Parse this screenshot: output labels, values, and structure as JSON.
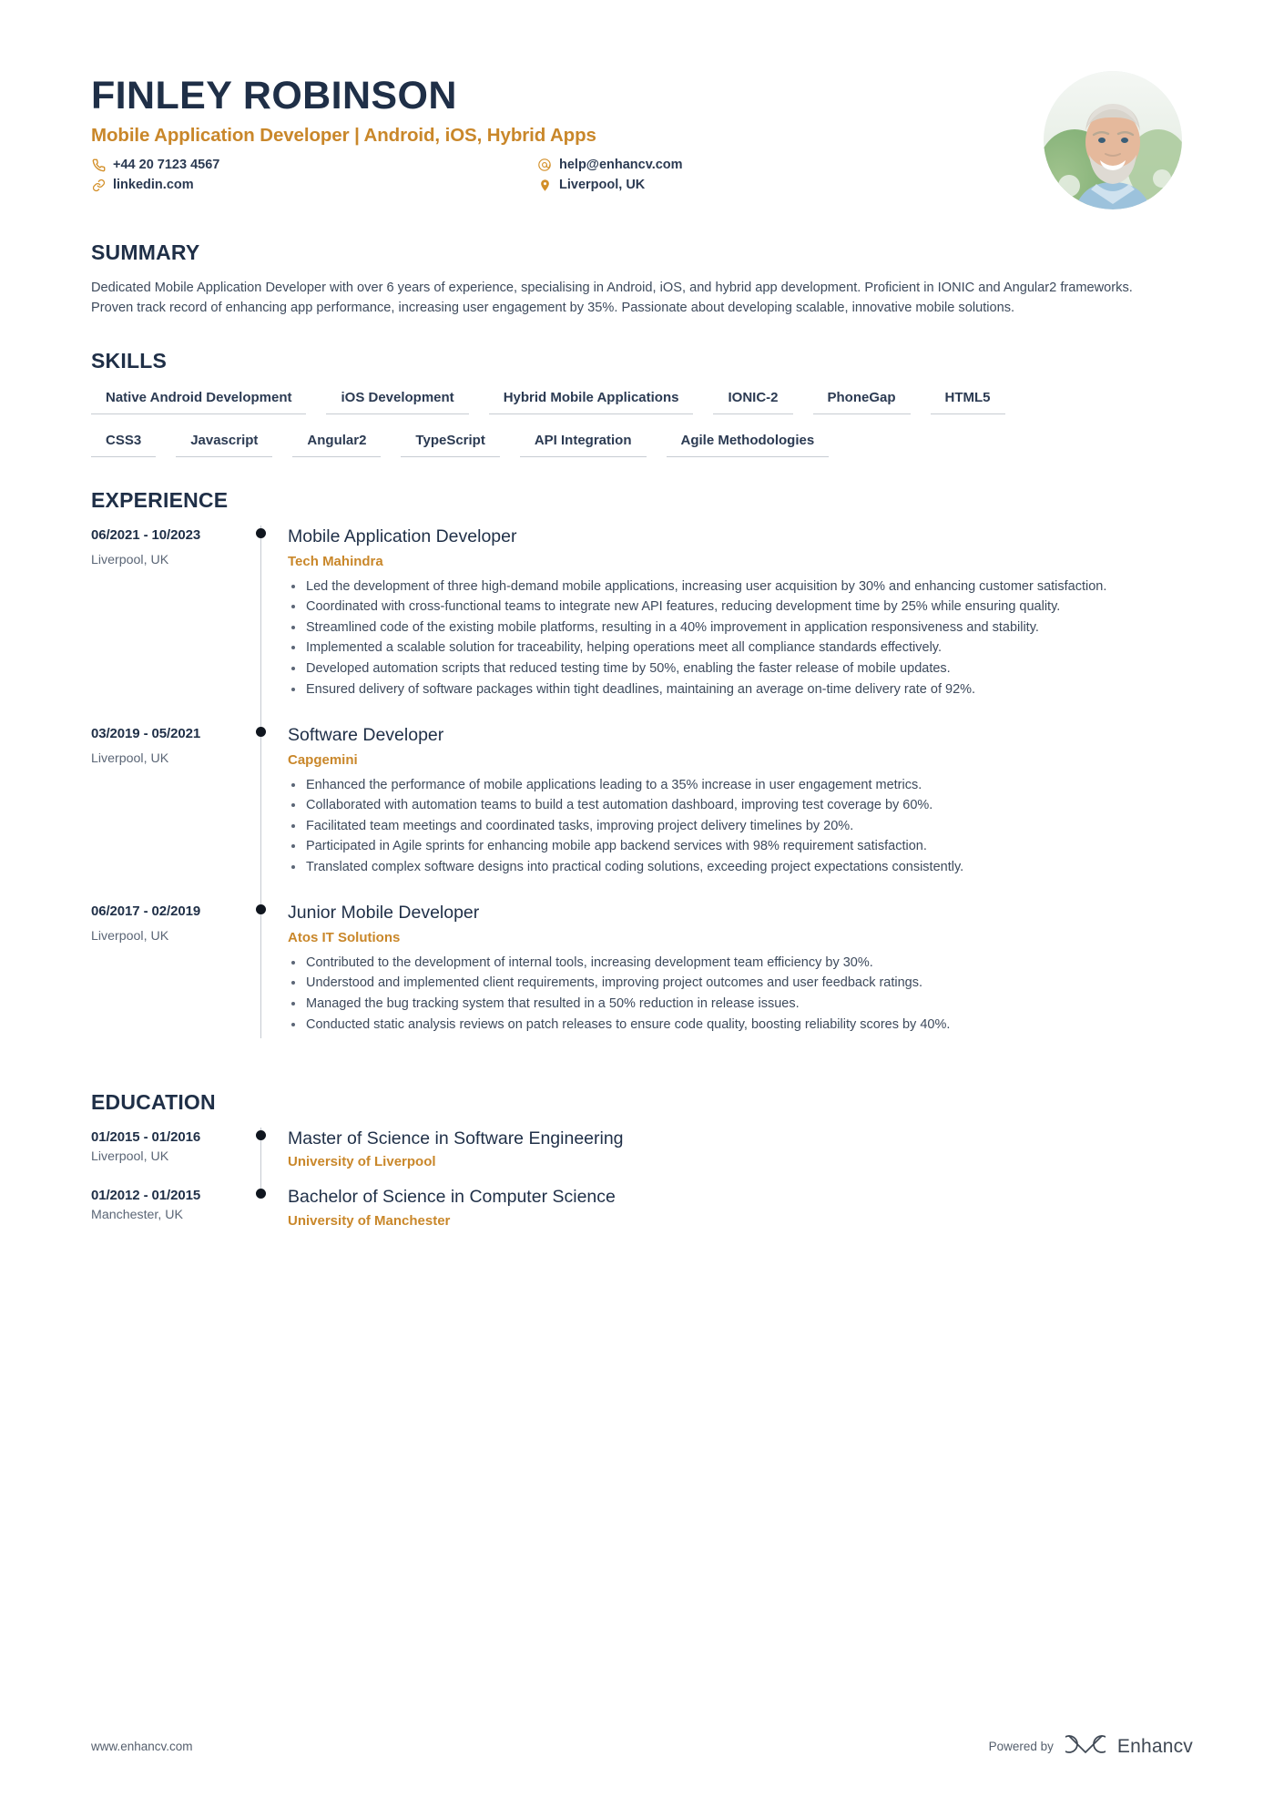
{
  "header": {
    "full_name": "FINLEY ROBINSON",
    "job_title": "Mobile Application Developer | Android, iOS, Hybrid Apps",
    "contacts": [
      {
        "icon": "phone-icon",
        "value": "+44 20 7123 4567"
      },
      {
        "icon": "email-icon",
        "value": "help@enhancv.com"
      },
      {
        "icon": "link-icon",
        "value": "linkedin.com"
      },
      {
        "icon": "location-pin-icon",
        "value": "Liverpool, UK"
      }
    ],
    "photo_alt": "profile-photo"
  },
  "summary": {
    "title": "SUMMARY",
    "text": "Dedicated Mobile Application Developer with over 6 years of experience, specialising in Android, iOS, and hybrid app development. Proficient in IONIC and Angular2 frameworks. Proven track record of enhancing app performance, increasing user engagement by 35%. Passionate about developing scalable, innovative mobile solutions."
  },
  "skills": {
    "title": "SKILLS",
    "rows": [
      [
        "Native Android Development",
        "iOS Development",
        "Hybrid Mobile Applications",
        "IONIC-2",
        "PhoneGap",
        "HTML5"
      ],
      [
        "CSS3",
        "Javascript",
        "Angular2",
        "TypeScript",
        "API Integration",
        "Agile Methodologies"
      ]
    ]
  },
  "experience": {
    "title": "EXPERIENCE",
    "entries": [
      {
        "date": "06/2021 - 10/2023",
        "location": "Liverpool, UK",
        "role": "Mobile Application Developer",
        "company": "Tech Mahindra",
        "bullets": [
          "Led the development of three high-demand mobile applications, increasing user acquisition by 30% and enhancing customer satisfaction.",
          "Coordinated with cross-functional teams to integrate new API features, reducing development time by 25% while ensuring quality.",
          "Streamlined code of the existing mobile platforms, resulting in a 40% improvement in application responsiveness and stability.",
          "Implemented a scalable solution for traceability, helping operations meet all compliance standards effectively.",
          "Developed automation scripts that reduced testing time by 50%, enabling the faster release of mobile updates.",
          "Ensured delivery of software packages within tight deadlines, maintaining an average on-time delivery rate of 92%."
        ]
      },
      {
        "date": "03/2019 - 05/2021",
        "location": "Liverpool, UK",
        "role": "Software Developer",
        "company": "Capgemini",
        "bullets": [
          "Enhanced the performance of mobile applications leading to a 35% increase in user engagement metrics.",
          "Collaborated with automation teams to build a test automation dashboard, improving test coverage by 60%.",
          "Facilitated team meetings and coordinated tasks, improving project delivery timelines by 20%.",
          "Participated in Agile sprints for enhancing mobile app backend services with 98% requirement satisfaction.",
          "Translated complex software designs into practical coding solutions, exceeding project expectations consistently."
        ]
      },
      {
        "date": "06/2017 - 02/2019",
        "location": "Liverpool, UK",
        "role": "Junior Mobile Developer",
        "company": "Atos IT Solutions",
        "bullets": [
          "Contributed to the development of internal tools, increasing development team efficiency by 30%.",
          "Understood and implemented client requirements, improving project outcomes and user feedback ratings.",
          "Managed the bug tracking system that resulted in a 50% reduction in release issues.",
          "Conducted static analysis reviews on patch releases to ensure code quality, boosting reliability scores by 40%."
        ]
      }
    ]
  },
  "education": {
    "title": "EDUCATION",
    "entries": [
      {
        "date": "01/2015 - 01/2016",
        "location": "Liverpool, UK",
        "degree": "Master of Science in Software Engineering",
        "school": "University of Liverpool"
      },
      {
        "date": "01/2012 - 01/2015",
        "location": "Manchester, UK",
        "degree": "Bachelor of Science in Computer Science",
        "school": "University of Manchester"
      }
    ]
  },
  "footer": {
    "url": "www.enhancv.com",
    "powered_by": "Powered by",
    "brand": "Enhancv",
    "brand_mark_icon": "enhancv-infinity-logo"
  },
  "colors": {
    "accent": "#c9872a",
    "heading": "#1f2f47",
    "body": "#3d4a5c",
    "muted": "#5b6676",
    "rule": "#c7ccd2"
  }
}
